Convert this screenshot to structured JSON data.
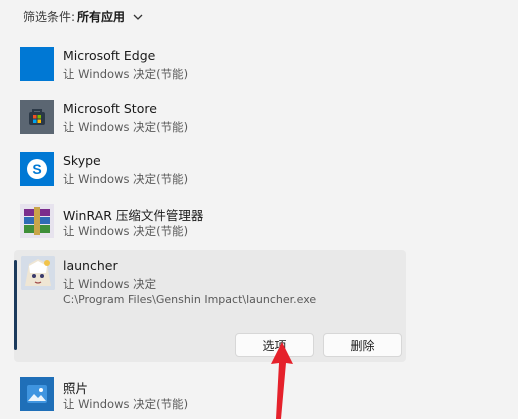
{
  "filter": {
    "label": "筛选条件:",
    "value": "所有应用",
    "icon": "chevron-down-icon"
  },
  "apps": [
    {
      "name": "Microsoft Edge",
      "mode": "让 Windows 决定(节能)",
      "icon": "edge-icon",
      "color": "#0078d4"
    },
    {
      "name": "Microsoft Store",
      "mode": "让 Windows 决定(节能)",
      "icon": "store-icon",
      "color": "#4a5a6a"
    },
    {
      "name": "Skype",
      "mode": "让 Windows 决定(节能)",
      "icon": "skype-icon",
      "color": "#0078d4"
    },
    {
      "name": "WinRAR 压缩文件管理器",
      "mode": "让 Windows 决定(节能)",
      "icon": "winrar-icon",
      "color": "#7b2d8c"
    }
  ],
  "expanded_app": {
    "name": "launcher",
    "mode": "让 Windows 决定",
    "path": "C:\\Program Files\\Genshin Impact\\launcher.exe",
    "icon": "launcher-icon",
    "options_label": "选项",
    "delete_label": "删除"
  },
  "bottom_app": {
    "name": "照片",
    "mode": "让 Windows 决定(节能)",
    "icon": "photos-icon",
    "color": "#1f6fb8"
  },
  "accent_arrow_color": "#e5212b"
}
